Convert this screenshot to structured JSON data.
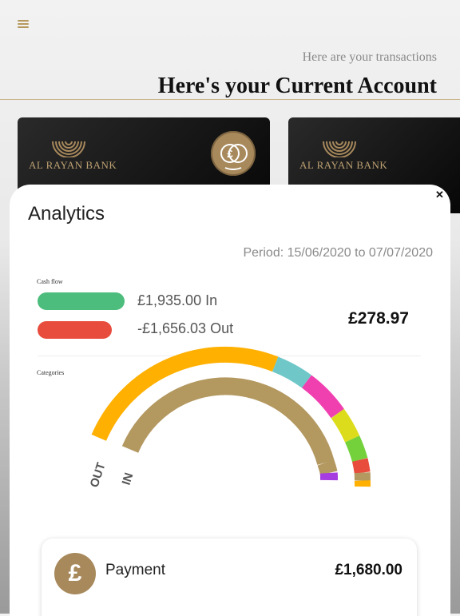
{
  "header": {
    "subtitle": "Here are your transactions",
    "title": "Here's your Current Account"
  },
  "cards": [
    {
      "bank_name": "AL RAYAN BANK",
      "icon": "pound-coin-icon"
    },
    {
      "bank_name": "AL RAYAN BANK"
    }
  ],
  "analytics": {
    "title": "Analytics",
    "period": "Period: 15/06/2020 to 07/07/2020",
    "cash_flow_label": "Cash flow",
    "in_text": "£1,935.00 In",
    "out_text": "-£1,656.03 Out",
    "balance": "£278.97",
    "categories_label": "Categories",
    "out_label": "OUT",
    "in_label": "IN",
    "colors": {
      "in_pill": "#4cbd7c",
      "out_pill": "#e74c3c",
      "gold": "#b39860",
      "orange": "#ffb000"
    },
    "payment": {
      "icon": "pound-icon",
      "label": "Payment",
      "amount": "£1,680.00"
    }
  }
}
